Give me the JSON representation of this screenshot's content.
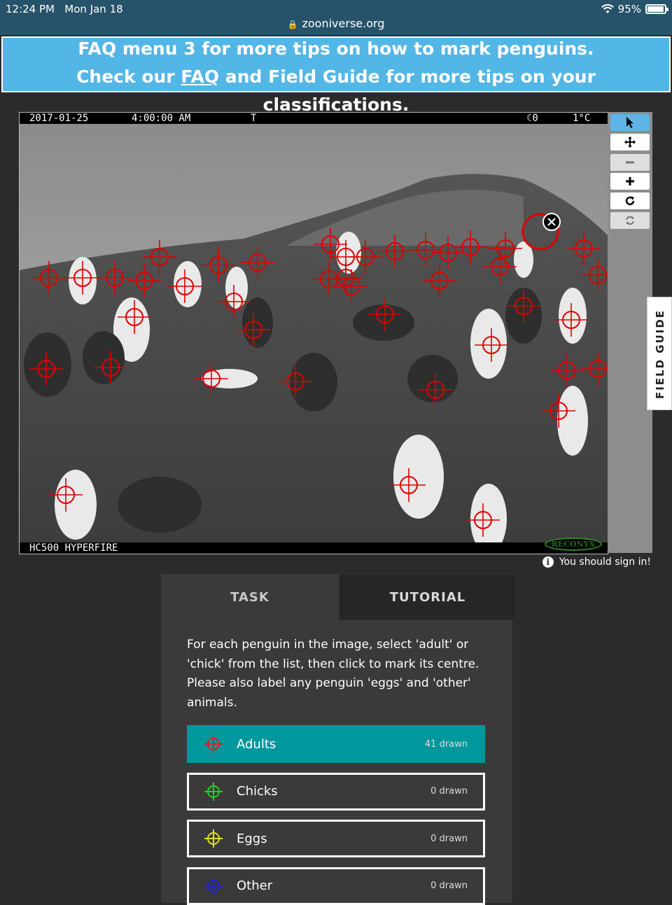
{
  "status_bar": {
    "time": "12:24 PM",
    "date": "Mon Jan 18",
    "url": "zooniverse.org",
    "battery": "95%",
    "battery_level": 0.95
  },
  "banner": {
    "line1": "FAQ menu 3 for more tips on how to mark penguins.",
    "line2_prefix": "Check our ",
    "line2_link": "FAQ",
    "line2_suffix": " and Field Guide for more tips on your classifications."
  },
  "camera": {
    "date": "2017-01-25",
    "time": "4:00:00 AM",
    "flag": "T",
    "moon": "☾0",
    "temp": "1°C",
    "model": "HC500 HYPERFIRE",
    "brand": "RECONYX"
  },
  "tools": {
    "select": "select-icon",
    "pan": "move-icon",
    "zoom_out": "minus-icon",
    "zoom_in": "plus-icon",
    "rotate": "rotate-icon",
    "reset": "reset-icon"
  },
  "field_guide": "FIELD GUIDE",
  "sign_in_notice": "You should sign in!",
  "tabs": {
    "task": "TASK",
    "tutorial": "TUTORIAL"
  },
  "instructions": "For each penguin in the image, select 'adult' or 'chick' from the list, then click to mark its centre. Please also label any penguin 'eggs' and 'other' animals.",
  "choices": [
    {
      "label": "Adults",
      "count": "41 drawn",
      "color": "#e02020",
      "selected": true
    },
    {
      "label": "Chicks",
      "count": "0 drawn",
      "color": "#22d022",
      "selected": false
    },
    {
      "label": "Eggs",
      "count": "0 drawn",
      "color": "#e0e020",
      "selected": false
    },
    {
      "label": "Other",
      "count": "0 drawn",
      "color": "#2020d0",
      "selected": false
    }
  ],
  "colors": {
    "banner": "#52b6e6",
    "selected_choice": "#00979d",
    "marker": "#e00000",
    "active_tool": "#5db4e8"
  }
}
